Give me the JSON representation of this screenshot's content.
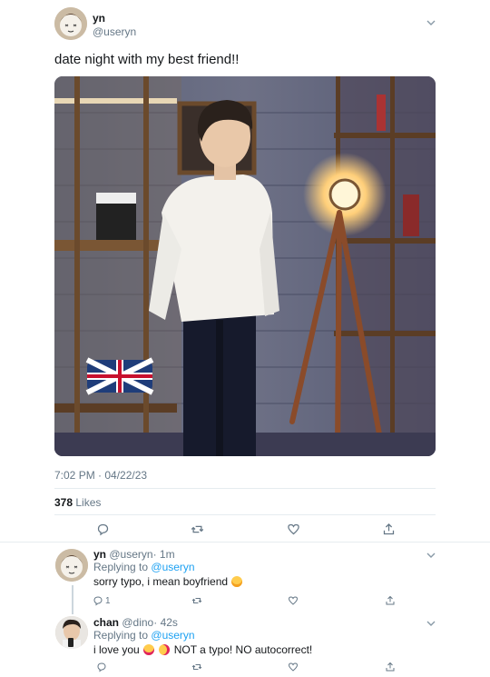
{
  "tweet": {
    "author_name": "yn",
    "author_handle": "@useryn",
    "text": "date night with my best friend!!",
    "timestamp": "7:02 PM · 04/22/23",
    "likes_count": "378",
    "likes_label": "Likes"
  },
  "replies": [
    {
      "author_name": "yn",
      "author_handle": "@useryn",
      "time": "· 1m",
      "replying_prefix": "Replying to",
      "replying_to": "@useryn",
      "text": "sorry typo, i mean boyfriend",
      "reply_count": "1"
    },
    {
      "author_name": "chan",
      "author_handle": "@dino",
      "time": "· 42s",
      "replying_prefix": "Replying to",
      "replying_to": "@useryn",
      "text_part1": "i love you",
      "text_part2": "NOT a typo! NO autocorrect!"
    }
  ],
  "colors": {
    "text": "#14171a",
    "secondary": "#657786",
    "link": "#1da1f2",
    "divider": "#e6ecf0"
  },
  "icons": [
    "chevron-down-icon",
    "reply-icon",
    "retweet-icon",
    "like-icon",
    "share-icon",
    "emoji-grin-sweat",
    "emoji-heart-eyes",
    "emoji-kiss"
  ]
}
